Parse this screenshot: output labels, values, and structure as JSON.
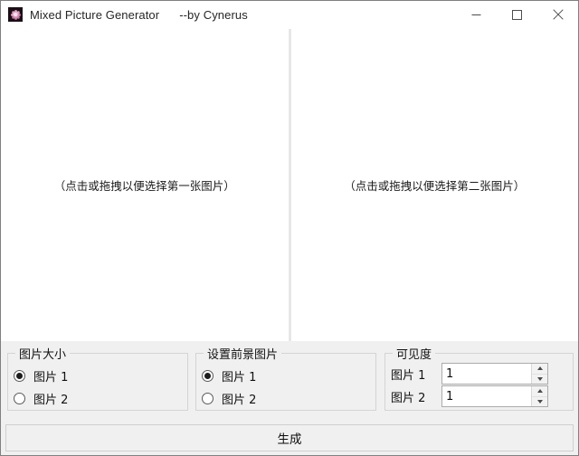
{
  "window": {
    "title": "Mixed Picture Generator",
    "subtitle": "--by Cynerus",
    "icon_name": "flower-app-icon",
    "controls": {
      "minimize": "minimize-icon",
      "maximize": "maximize-icon",
      "close": "close-icon"
    }
  },
  "image_area": {
    "left_panel_hint": "（点击或拖拽以便选择第一张图片）",
    "right_panel_hint": "（点击或拖拽以便选择第二张图片）"
  },
  "groups": {
    "size": {
      "title": "图片大小",
      "options": [
        {
          "label": "图片 1",
          "checked": true
        },
        {
          "label": "图片 2",
          "checked": false
        }
      ]
    },
    "foreground": {
      "title": "设置前景图片",
      "options": [
        {
          "label": "图片 1",
          "checked": true
        },
        {
          "label": "图片 2",
          "checked": false
        }
      ]
    },
    "visibility": {
      "title": "可见度",
      "fields": [
        {
          "label": "图片 1",
          "value": "1"
        },
        {
          "label": "图片 2",
          "value": "1"
        }
      ]
    }
  },
  "actions": {
    "generate_label": "生成"
  },
  "colors": {
    "window_background": "#f0f0f0",
    "panel_background": "#ffffff",
    "divider": "#e4e4e4",
    "border": "#d4d4d4",
    "text": "#111111"
  }
}
